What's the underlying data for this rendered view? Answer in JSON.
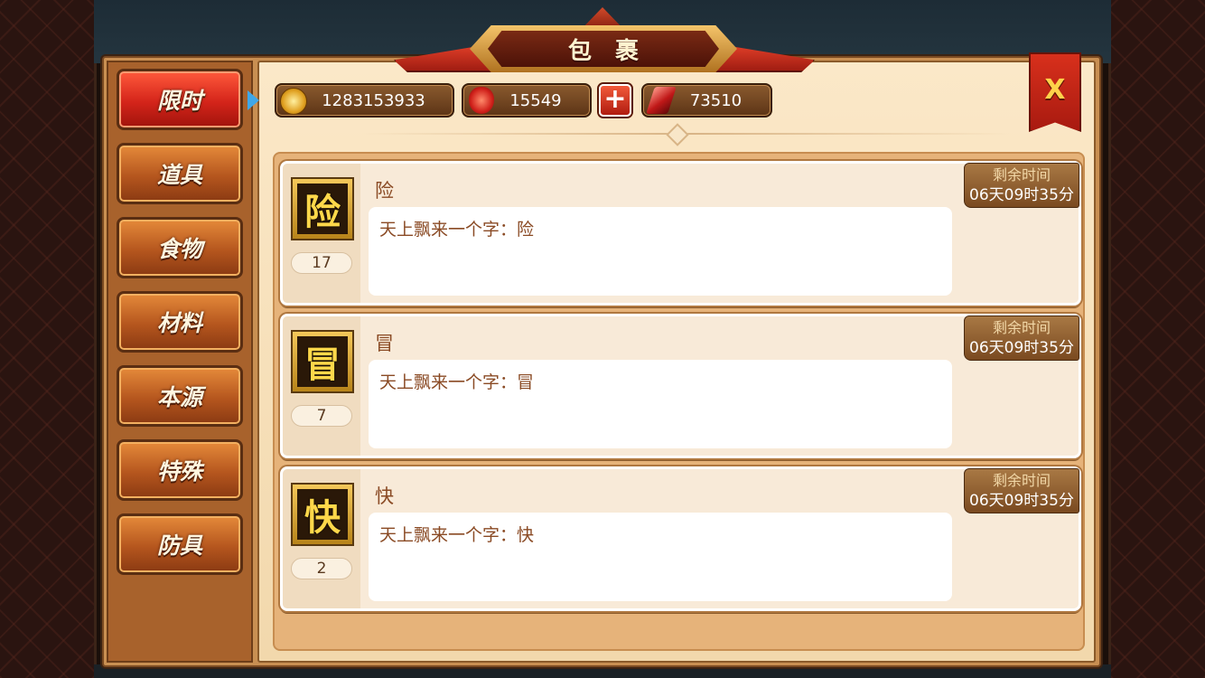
{
  "title": "包裹",
  "close_label": "X",
  "plus_label": "+",
  "tabs": [
    {
      "label": "限时",
      "active": true
    },
    {
      "label": "道具"
    },
    {
      "label": "食物"
    },
    {
      "label": "材料"
    },
    {
      "label": "本源"
    },
    {
      "label": "特殊"
    },
    {
      "label": "防具"
    }
  ],
  "currency": {
    "gold": {
      "icon": "gold-coin-icon",
      "value": "1283153933"
    },
    "gems": {
      "icon": "red-gem-icon",
      "value": "15549"
    },
    "crystal": {
      "icon": "red-crystal-icon",
      "value": "73510"
    }
  },
  "items": [
    {
      "glyph": "险",
      "name": "险",
      "quantity": "17",
      "desc": "天上飘来一个字：险",
      "timer_label": "剩余时间",
      "timer_value": "06天09时35分"
    },
    {
      "glyph": "冒",
      "name": "冒",
      "quantity": "7",
      "desc": "天上飘来一个字：冒",
      "timer_label": "剩余时间",
      "timer_value": "06天09时35分"
    },
    {
      "glyph": "快",
      "name": "快",
      "quantity": "2",
      "desc": "天上飘来一个字：快",
      "timer_label": "剩余时间",
      "timer_value": "06天09时35分"
    }
  ],
  "colors": {
    "accent_red": "#d4241a",
    "frame_brown": "#a8622c",
    "parchment": "#f8ead8",
    "timer_text": "#f2d8a8"
  }
}
